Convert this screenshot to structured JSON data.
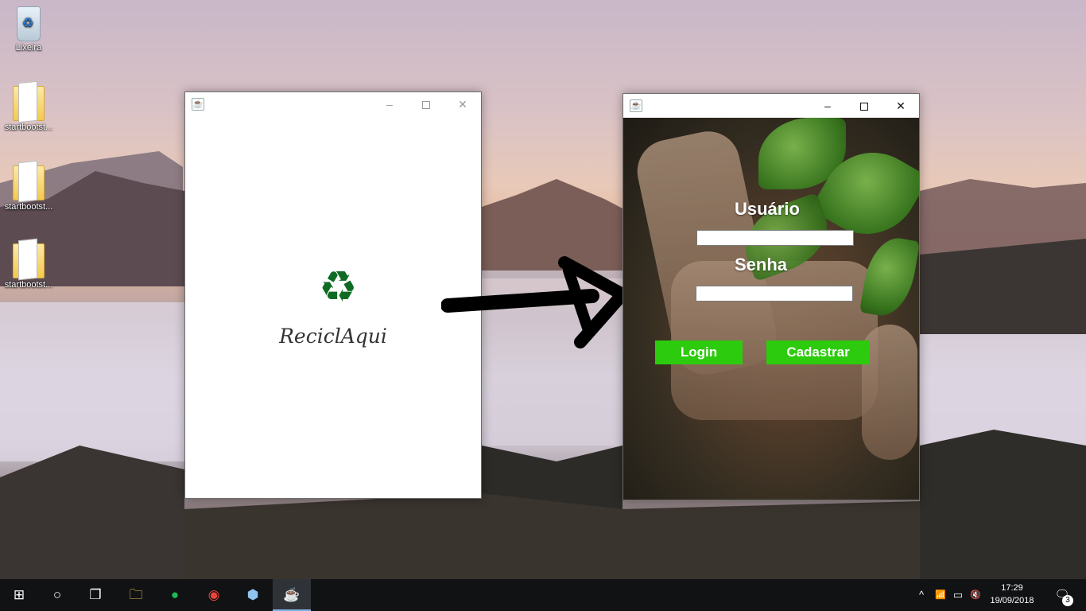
{
  "desktop": {
    "icons": [
      {
        "label": "Lixeira",
        "icon": "recycle-bin-icon"
      },
      {
        "label": "startbootst...",
        "icon": "folder-icon"
      },
      {
        "label": "startbootst...",
        "icon": "folder-icon"
      },
      {
        "label": "startbootst...",
        "icon": "folder-icon"
      }
    ]
  },
  "splash_window": {
    "brand": "ReciclAqui",
    "logo_glyph": "♻",
    "logo_color": "#0f6b23"
  },
  "login_window": {
    "username_label": "Usuário",
    "username_value": "",
    "password_label": "Senha",
    "password_value": "",
    "login_button": "Login",
    "register_button": "Cadastrar",
    "accent": "#2dcb0d"
  },
  "window_controls": {
    "minimize": "–",
    "close": "✕"
  },
  "taskbar": {
    "start": "⊞",
    "search": "○",
    "task_view": "❐",
    "explorer": "🗀",
    "spotify": "●",
    "chrome": "◉",
    "app": "⬢",
    "java": "☕",
    "tray_chevron": "^",
    "wifi": "📶",
    "battery": "▭",
    "volume": "🔇",
    "time": "17:29",
    "date": "19/09/2018",
    "notifications_icon": "🗨",
    "notifications_count": "3"
  }
}
